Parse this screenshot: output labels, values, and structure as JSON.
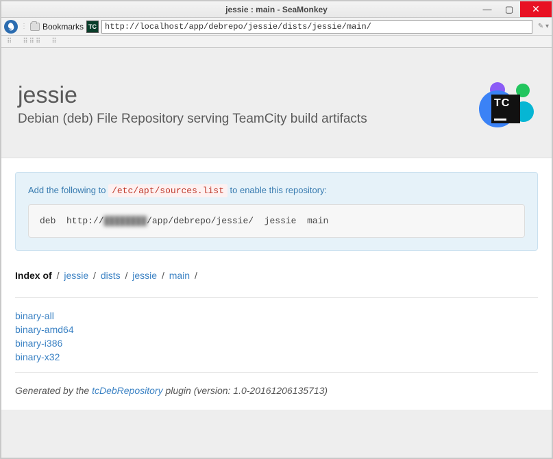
{
  "window": {
    "title": "jessie : main - SeaMonkey",
    "bookmarks_label": "Bookmarks",
    "url": "http://localhost/app/debrepo/jessie/dists/jessie/main/"
  },
  "page": {
    "title": "jessie",
    "subtitle": "Debian (deb) File Repository serving TeamCity build artifacts"
  },
  "info": {
    "pre_text": "Add the following to ",
    "code_path": "/etc/apt/sources.list",
    "post_text": " to enable this repository:",
    "deb_prefix": "deb  http://",
    "deb_host_redacted": "████████",
    "deb_suffix": "/app/debrepo/jessie/  jessie  main"
  },
  "breadcrumb": {
    "label": "Index of",
    "segments": [
      "jessie",
      "dists",
      "jessie",
      "main"
    ]
  },
  "listing": [
    "binary-all",
    "binary-amd64",
    "binary-i386",
    "binary-x32"
  ],
  "footer": {
    "pre": "Generated by the ",
    "link": "tcDebRepository",
    "post": " plugin (version: 1.0-20161206135713)"
  }
}
